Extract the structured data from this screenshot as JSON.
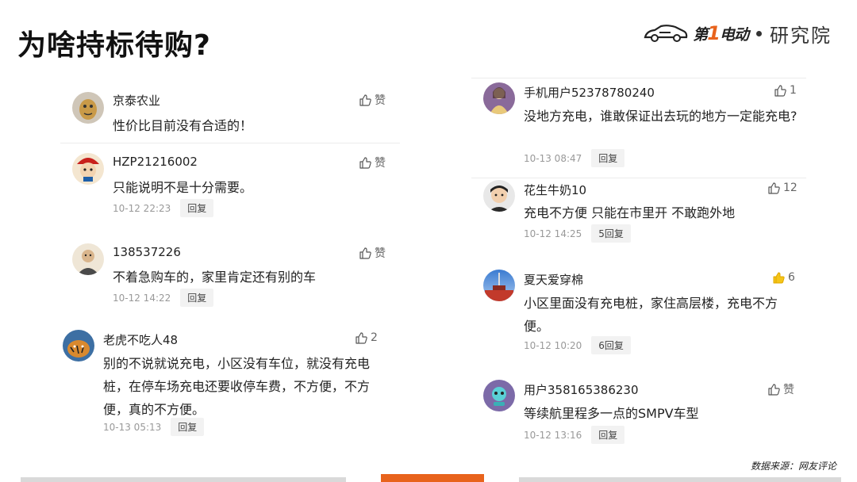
{
  "slide": {
    "title": "为啥持标待购?",
    "logo": {
      "brand_prefix": "第",
      "brand_one": "1",
      "brand_suffix": "电动",
      "institute": "研究院"
    },
    "source": "数据来源：网友评论",
    "colors": {
      "accent": "#e8631c",
      "like_active": "#f5c518"
    }
  },
  "left_comments": [
    {
      "name": "京泰农业",
      "like": "赞",
      "text": "性价比目前没有合适的！"
    },
    {
      "name": "HZP21216002",
      "like": "赞",
      "text": "只能说明不是十分需要。",
      "date": "10-12 22:23",
      "reply": "回复"
    },
    {
      "name": "138537226",
      "like": "赞",
      "text": "不着急购车的，家里肯定还有别的车",
      "date": "10-12 14:22",
      "reply": "回复"
    },
    {
      "name": "老虎不吃人48",
      "like": "2",
      "text": "别的不说就说充电，小区没有车位，就没有充电桩，在停车场充电还要收停车费，不方便，不方便，真的不方便。",
      "date": "10-13 05:13",
      "reply": "回复"
    }
  ],
  "right_comments": [
    {
      "name": "手机用户52378780240",
      "like": "1",
      "text": "没地方充电，谁敢保证出去玩的地方一定能充电?",
      "date": "10-13 08:47",
      "reply": "回复"
    },
    {
      "name": "花生牛奶10",
      "like": "12",
      "text": "充电不方便 只能在市里开 不敢跑外地",
      "date": "10-12 14:25",
      "reply": "5回复"
    },
    {
      "name": "夏天爱穿棉",
      "like": "6",
      "text": "小区里面没有充电桩，家住高层楼，充电不方便。",
      "date": "10-12 10:20",
      "reply": "6回复"
    },
    {
      "name": "用户358165386230",
      "like": "赞",
      "text": "等续航里程多一点的SMPV车型",
      "date": "10-12 13:16",
      "reply": "回复"
    }
  ]
}
